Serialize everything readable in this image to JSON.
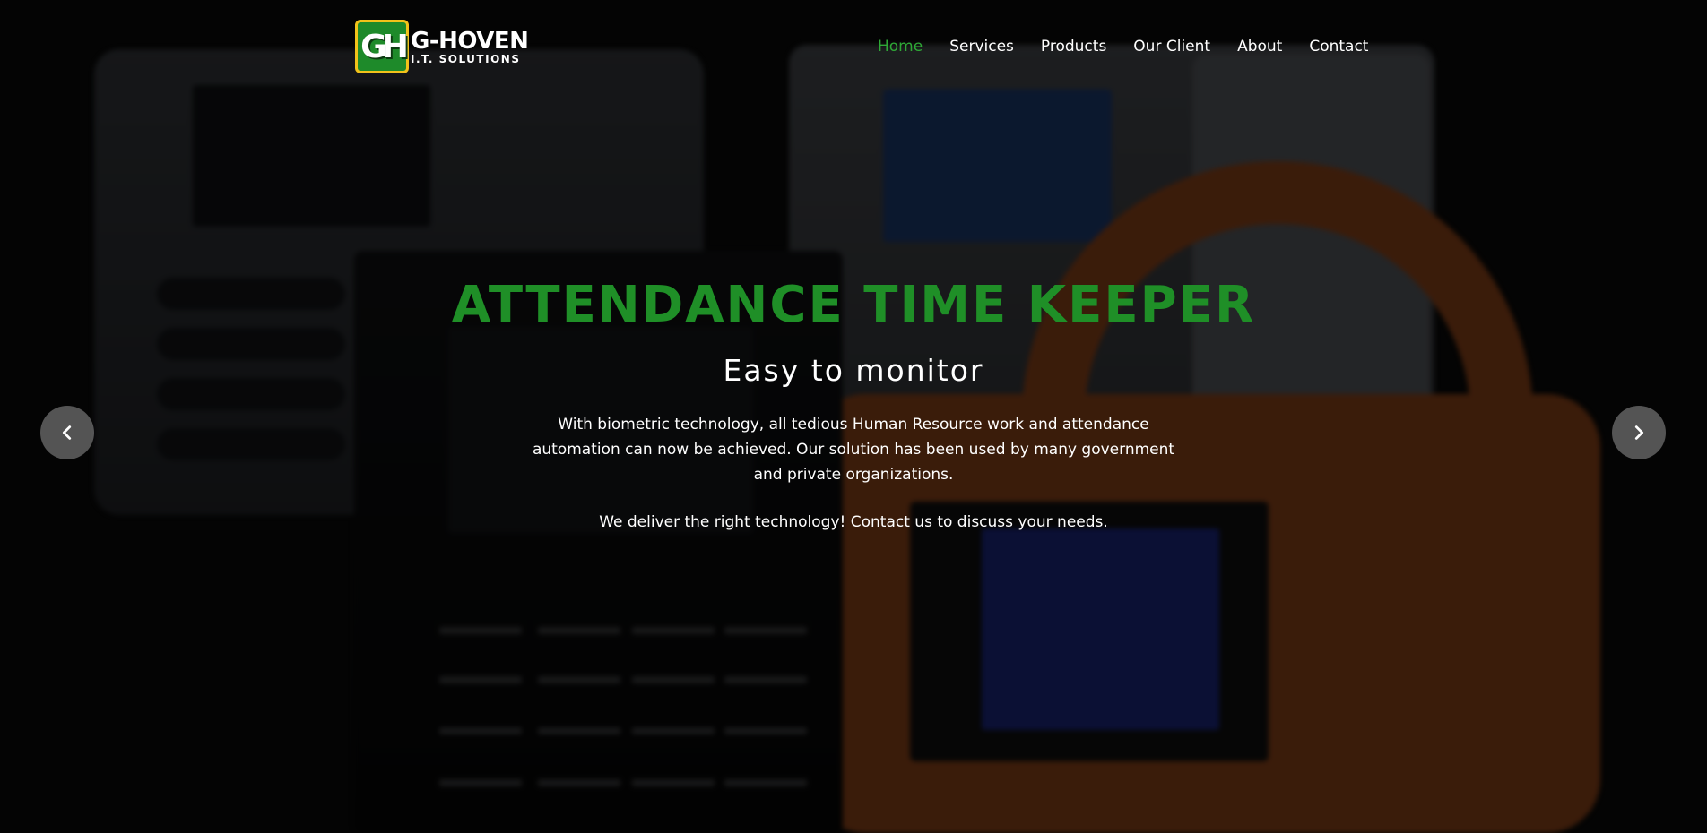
{
  "brand": {
    "logo_mark": "GH",
    "name": "G-HOVEN",
    "tagline": "I.T. SOLUTIONS",
    "colors": {
      "green": "#1f8f27",
      "gold": "#f2c21a"
    }
  },
  "nav": {
    "items": [
      {
        "label": "Home",
        "active": true
      },
      {
        "label": "Services",
        "active": false
      },
      {
        "label": "Products",
        "active": false
      },
      {
        "label": "Our Client",
        "active": false
      },
      {
        "label": "About",
        "active": false
      },
      {
        "label": "Contact",
        "active": false
      }
    ],
    "active_color": "#2ea836"
  },
  "hero": {
    "title": "ATTENDANCE TIME KEEPER",
    "subtitle": "Easy to monitor",
    "description": "With biometric technology, all tedious Human Resource work and attendance automation can now be achieved. Our solution has been used by many government and private organizations.",
    "cta_text": "We deliver the right technology! Contact us to discuss your needs."
  },
  "carousel": {
    "prev_icon": "chevron-left-icon",
    "next_icon": "chevron-right-icon"
  }
}
